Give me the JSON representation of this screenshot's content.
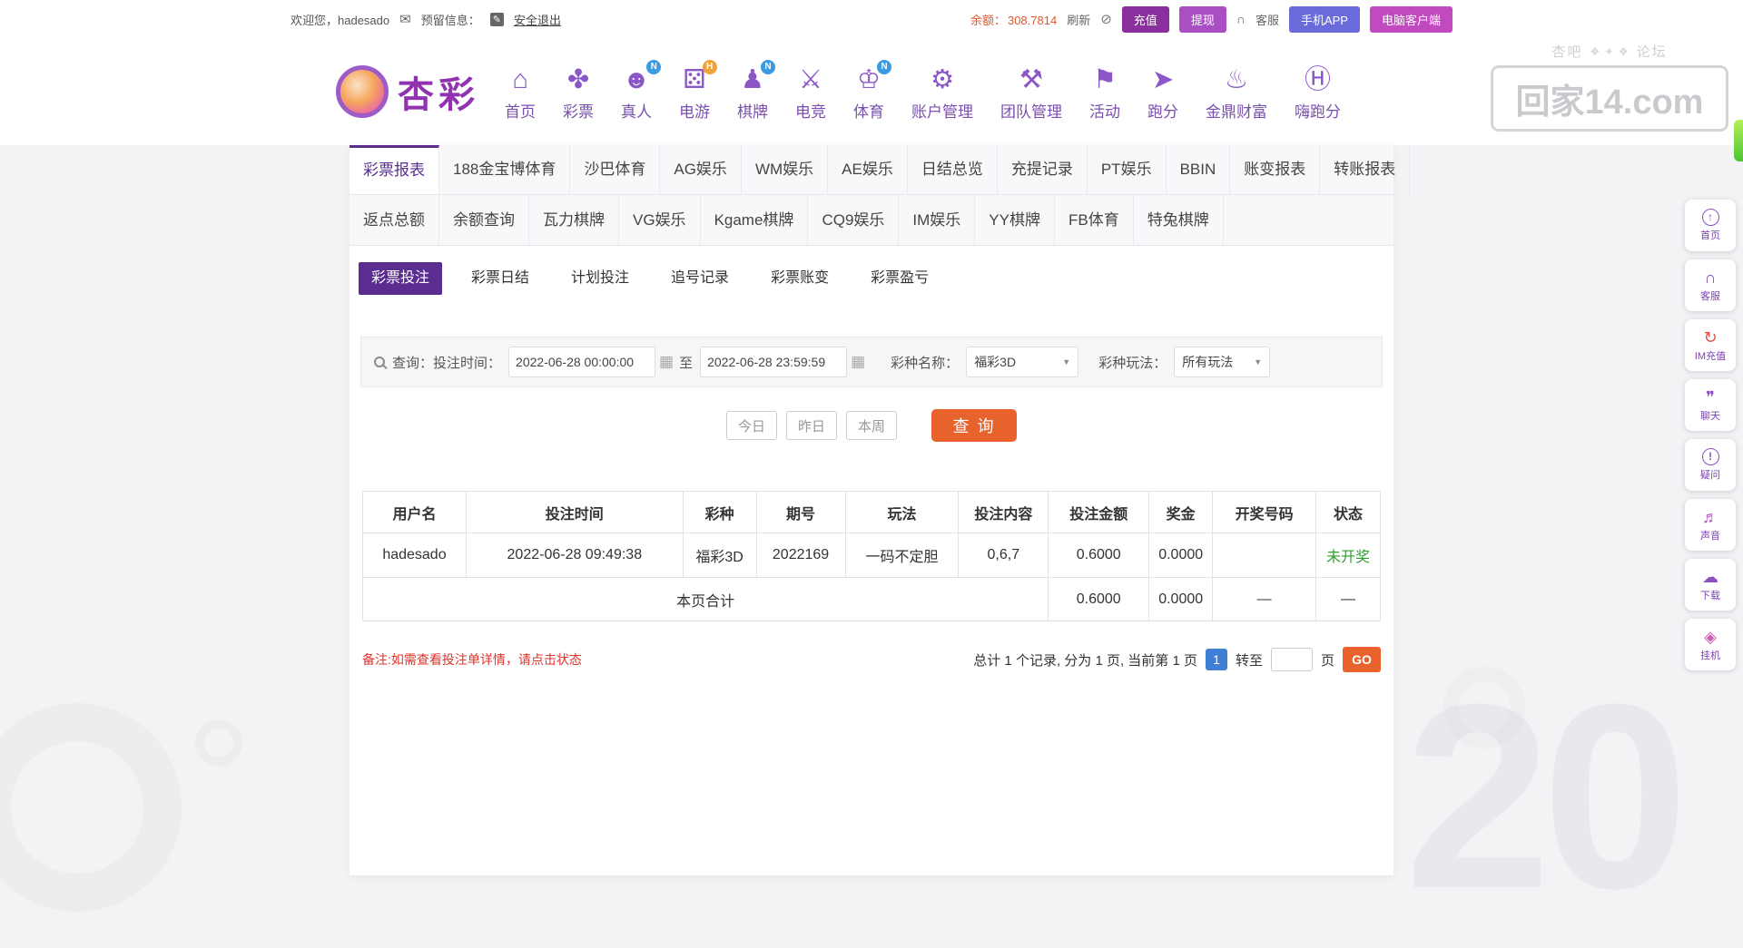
{
  "topbar": {
    "welcome": "欢迎您，hadesado",
    "reserved_label": "预留信息：",
    "logout": "安全退出",
    "balance_label": "余额：",
    "balance_value": "308.7814",
    "refresh": "刷新",
    "recharge": "充值",
    "withdraw": "提现",
    "service": "客服",
    "mobile_app": "手机APP",
    "pc_client": "电脑客户端"
  },
  "brand": {
    "name": "杏彩"
  },
  "watermark": {
    "left": "杏吧",
    "right": "论坛",
    "ornament": "❖ ✦ ❖",
    "domain": "回家14.com"
  },
  "main_nav": [
    {
      "key": "home",
      "label": "首页"
    },
    {
      "key": "lottery",
      "label": "彩票"
    },
    {
      "key": "live",
      "label": "真人",
      "badge": "N"
    },
    {
      "key": "egames",
      "label": "电游",
      "badge": "H"
    },
    {
      "key": "chess",
      "label": "棋牌",
      "badge": "N"
    },
    {
      "key": "esports",
      "label": "电竞"
    },
    {
      "key": "sports",
      "label": "体育",
      "badge": "N"
    },
    {
      "key": "account",
      "label": "账户管理"
    },
    {
      "key": "team",
      "label": "团队管理"
    },
    {
      "key": "activity",
      "label": "活动"
    },
    {
      "key": "paofen",
      "label": "跑分"
    },
    {
      "key": "jinding",
      "label": "金鼎财富"
    },
    {
      "key": "hipaofen",
      "label": "嗨跑分"
    }
  ],
  "report_tabs": {
    "row1": [
      "彩票报表",
      "188金宝博体育",
      "沙巴体育",
      "AG娱乐",
      "WM娱乐",
      "AE娱乐",
      "日结总览",
      "充提记录",
      "PT娱乐",
      "BBIN",
      "账变报表",
      "转账报表"
    ],
    "row1_active": "彩票报表",
    "row2": [
      "返点总额",
      "余额查询",
      "瓦力棋牌",
      "VG娱乐",
      "Kgame棋牌",
      "CQ9娱乐",
      "IM娱乐",
      "YY棋牌",
      "FB体育",
      "特兔棋牌"
    ]
  },
  "sub_tabs": {
    "items": [
      "彩票投注",
      "彩票日结",
      "计划投注",
      "追号记录",
      "彩票账变",
      "彩票盈亏"
    ],
    "active": "彩票投注"
  },
  "filters": {
    "query_label": "查询：",
    "bet_time_label": "投注时间：",
    "start_time": "2022-06-28 00:00:00",
    "to_label": "至",
    "end_time": "2022-06-28 23:59:59",
    "lottery_label": "彩种名称：",
    "lottery_value": "福彩3D",
    "play_label": "彩种玩法：",
    "play_value": "所有玩法"
  },
  "quick_filters": [
    "今日",
    "昨日",
    "本周"
  ],
  "search_button": "查 询",
  "table": {
    "headers": [
      "用户名",
      "投注时间",
      "彩种",
      "期号",
      "玩法",
      "投注内容",
      "投注金额",
      "奖金",
      "开奖号码",
      "状态"
    ],
    "rows": [
      [
        "hadesado",
        "2022-06-28 09:49:38",
        "福彩3D",
        "2022169",
        "一码不定胆",
        "0,6,7",
        "0.6000",
        "0.0000",
        "",
        "未开奖"
      ]
    ],
    "summary": {
      "label": "本页合计",
      "values": [
        "0.6000",
        "0.0000",
        "—",
        "—"
      ]
    }
  },
  "footer": {
    "note": "备注:如需查看投注单详情，请点击状态",
    "total_text": "总计 1 个记录, 分为 1 页, 当前第 1 页",
    "current_page": "1",
    "goto_label": "转至",
    "page_unit": "页",
    "go": "GO"
  },
  "side_widgets": [
    {
      "key": "home-top",
      "label": "首页"
    },
    {
      "key": "service",
      "label": "客服"
    },
    {
      "key": "im-recharge",
      "label": "IM充值"
    },
    {
      "key": "chat",
      "label": "聊天"
    },
    {
      "key": "question",
      "label": "疑问"
    },
    {
      "key": "sound",
      "label": "声音"
    },
    {
      "key": "download",
      "label": "下载"
    },
    {
      "key": "hangup",
      "label": "挂机"
    }
  ],
  "colors": {
    "accent_purple": "#5c2d91",
    "accent_orange": "#e8632c",
    "status_green": "#2f9e2f",
    "note_red": "#e0332b",
    "balance_orange": "#e2572b",
    "page_badge_blue": "#3f7fd5"
  }
}
